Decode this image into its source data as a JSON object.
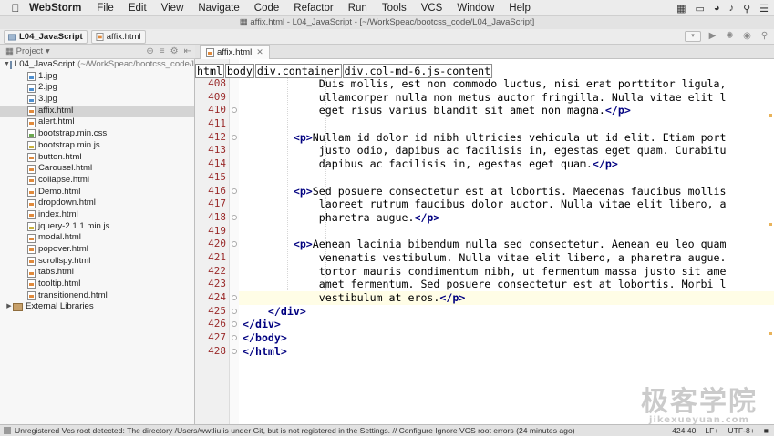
{
  "menubar": {
    "app_name": "WebStorm",
    "items": [
      "File",
      "Edit",
      "View",
      "Navigate",
      "Code",
      "Refactor",
      "Run",
      "Tools",
      "VCS",
      "Window",
      "Help"
    ]
  },
  "window": {
    "title": "affix.html - L04_JavaScript - [~/WorkSpeac/bootcss_code/L04_JavaScript]"
  },
  "navbar": {
    "crumbs": [
      "L04_JavaScript",
      "affix.html"
    ]
  },
  "project_panel": {
    "title": "Project",
    "root_name": "L04_JavaScript",
    "root_path": "(~/WorkSpeac/bootcss_code/L0",
    "files": [
      {
        "name": "1.jpg",
        "type": "jpg"
      },
      {
        "name": "2.jpg",
        "type": "jpg"
      },
      {
        "name": "3.jpg",
        "type": "jpg"
      },
      {
        "name": "affix.html",
        "type": "html"
      },
      {
        "name": "alert.html",
        "type": "html"
      },
      {
        "name": "bootstrap.min.css",
        "type": "css"
      },
      {
        "name": "bootstrap.min.js",
        "type": "js"
      },
      {
        "name": "button.html",
        "type": "html"
      },
      {
        "name": "Carousel.html",
        "type": "html"
      },
      {
        "name": "collapse.html",
        "type": "html"
      },
      {
        "name": "Demo.html",
        "type": "html"
      },
      {
        "name": "dropdown.html",
        "type": "html"
      },
      {
        "name": "index.html",
        "type": "html"
      },
      {
        "name": "jquery-2.1.1.min.js",
        "type": "js"
      },
      {
        "name": "modal.html",
        "type": "html"
      },
      {
        "name": "popover.html",
        "type": "html"
      },
      {
        "name": "scrollspy.html",
        "type": "html"
      },
      {
        "name": "tabs.html",
        "type": "html"
      },
      {
        "name": "tooltip.html",
        "type": "html"
      },
      {
        "name": "transitionend.html",
        "type": "html"
      }
    ],
    "selected_file": "affix.html",
    "external_libraries": "External Libraries"
  },
  "editor": {
    "tab_label": "affix.html",
    "breadcrumbs": [
      "html",
      "body",
      "div.container",
      "div.col-md-6.js-content"
    ],
    "current_line": "424",
    "lines": [
      {
        "n": "408",
        "text": "            Duis mollis, est non commodo luctus, nisi erat porttitor ligula,"
      },
      {
        "n": "409",
        "text": "            ullamcorper nulla non metus auctor fringilla. Nulla vitae elit l"
      },
      {
        "n": "410",
        "text": "            eget risus varius blandit sit amet non magna.</p>"
      },
      {
        "n": "411",
        "text": ""
      },
      {
        "n": "412",
        "text": "        <p>Nullam id dolor id nibh ultricies vehicula ut id elit. Etiam port"
      },
      {
        "n": "413",
        "text": "            justo odio, dapibus ac facilisis in, egestas eget quam. Curabitu"
      },
      {
        "n": "414",
        "text": "            dapibus ac facilisis in, egestas eget quam.</p>"
      },
      {
        "n": "415",
        "text": ""
      },
      {
        "n": "416",
        "text": "        <p>Sed posuere consectetur est at lobortis. Maecenas faucibus mollis"
      },
      {
        "n": "417",
        "text": "            laoreet rutrum faucibus dolor auctor. Nulla vitae elit libero, a"
      },
      {
        "n": "418",
        "text": "            pharetra augue.</p>"
      },
      {
        "n": "419",
        "text": ""
      },
      {
        "n": "420",
        "text": "        <p>Aenean lacinia bibendum nulla sed consectetur. Aenean eu leo quam"
      },
      {
        "n": "421",
        "text": "            venenatis vestibulum. Nulla vitae elit libero, a pharetra augue."
      },
      {
        "n": "422",
        "text": "            tortor mauris condimentum nibh, ut fermentum massa justo sit ame"
      },
      {
        "n": "423",
        "text": "            amet fermentum. Sed posuere consectetur est at lobortis. Morbi l"
      },
      {
        "n": "424",
        "text": "            vestibulum at eros.</p>"
      },
      {
        "n": "425",
        "text": "    </div>"
      },
      {
        "n": "426",
        "text": "</div>"
      },
      {
        "n": "427",
        "text": "</body>"
      },
      {
        "n": "428",
        "text": "</html>"
      }
    ]
  },
  "statusbar": {
    "message": "Unregistered Vcs root detected: The directory /Users/wwtliu is under Git, but is not registered in the Settings. // Configure  Ignore VCS root errors (24 minutes ago)",
    "position": "424:40",
    "line_sep": "LF+",
    "encoding": "UTF-8+"
  },
  "watermark": {
    "big": "极客学院",
    "small": "jikexueyuan.com"
  }
}
